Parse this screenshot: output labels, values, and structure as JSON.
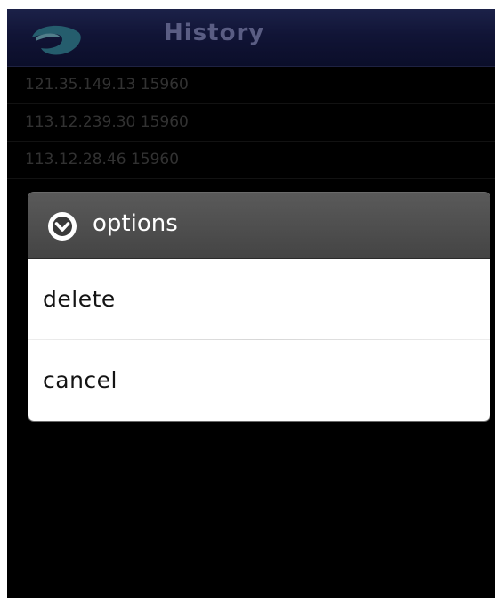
{
  "app": {
    "title": "History"
  },
  "history": {
    "items": [
      {
        "label": "121.35.149.13 15960"
      },
      {
        "label": "113.12.239.30 15960"
      },
      {
        "label": "113.12.28.46 15960"
      }
    ]
  },
  "dialog": {
    "icon": "chevron-down-circle-icon",
    "title": "options",
    "options": [
      {
        "label": "delete"
      },
      {
        "label": "cancel"
      }
    ]
  },
  "colors": {
    "titlebar": "#1b2054",
    "title_text": "#8b90c9",
    "list_text": "#4e4e4e",
    "dialog_header": "#4c4c4c",
    "dialog_body": "#ffffff"
  }
}
